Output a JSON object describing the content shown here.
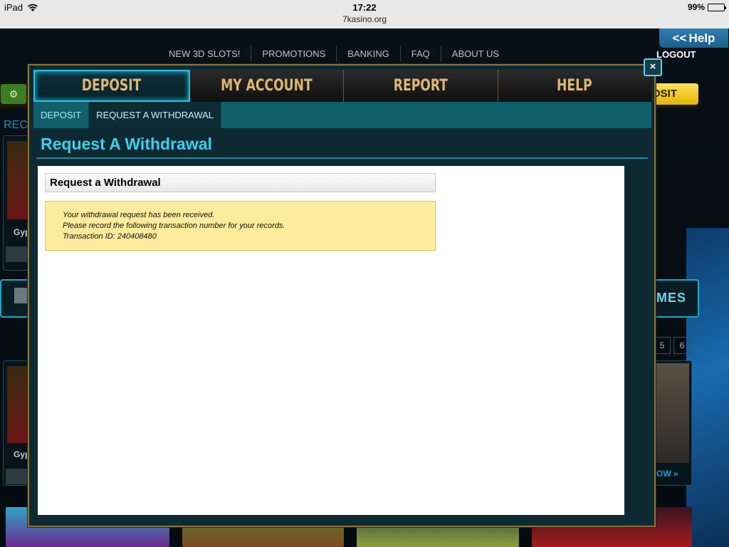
{
  "status_bar": {
    "device": "iPad",
    "time": "17:22",
    "url": "7kasino.org",
    "battery": "99%"
  },
  "site": {
    "nav": [
      "NEW 3D SLOTS!",
      "PROMOTIONS",
      "BANKING",
      "FAQ",
      "ABOUT US"
    ],
    "help_label": "Help",
    "help_arrows": "<<",
    "logout": "LOGOUT",
    "deposit_partial": "OSIT",
    "recent_partial": "REC",
    "games_partial": "MES",
    "page_numbers": [
      "5",
      "6"
    ],
    "show_more": "OW »",
    "game_name_partial": "Gyp"
  },
  "modal": {
    "close_label": "×",
    "main_tabs": [
      {
        "label": "DEPOSIT",
        "active": true
      },
      {
        "label": "MY ACCOUNT",
        "active": false
      },
      {
        "label": "REPORT",
        "active": false
      },
      {
        "label": "HELP",
        "active": false
      }
    ],
    "sub_tabs": [
      {
        "label": "DEPOSIT",
        "active": false
      },
      {
        "label": "REQUEST A WITHDRAWAL",
        "active": true
      }
    ],
    "heading": "Request A Withdrawal",
    "box_title": "Request a Withdrawal",
    "notice_lines": [
      "Your withdrawal request has been received.",
      "Please record the following transaction number for your records.",
      "Transaction ID: 240408480"
    ]
  },
  "colors": {
    "accent_cyan": "#38d2ec",
    "gold_tab_text": "#dcb870",
    "notice_bg": "#fdec9d"
  }
}
